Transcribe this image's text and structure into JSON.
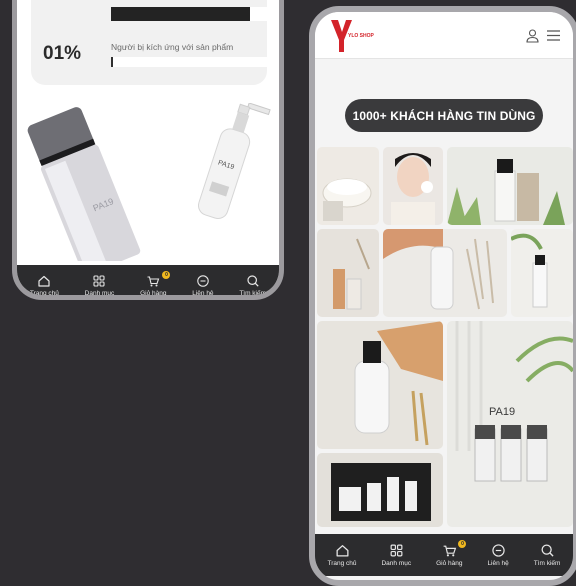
{
  "left_phone": {
    "rating": {
      "top_bar_fill": 0.88,
      "percent_text": "01%",
      "label": "Người bị kích ứng với sản phẩm",
      "bottom_bar_fill": 0.01
    }
  },
  "right_phone": {
    "brand_logo_letter": "Y",
    "brand_logo_sub": "YLO SHOP",
    "banner_label": "1000+ KHÁCH HÀNG TIN DÙNG",
    "gallery_items": [
      "product-photo",
      "customer-photo",
      "product-photo",
      "product-photo",
      "product-photo",
      "product-photo",
      "product-photo",
      "product-photo",
      "product-photo"
    ]
  },
  "nav": {
    "items": [
      {
        "label": "Trang chủ",
        "icon": "home-icon"
      },
      {
        "label": "Danh mục",
        "icon": "grid-icon"
      },
      {
        "label": "Giỏ hàng",
        "icon": "cart-icon",
        "badge": "0"
      },
      {
        "label": "Liên hệ",
        "icon": "chat-icon"
      },
      {
        "label": "Tìm kiếm",
        "icon": "search-icon"
      }
    ]
  },
  "colors": {
    "background": "#2f2d31",
    "nav_bg": "#2c2c2e",
    "badge": "#f0b81f",
    "brand_red": "#d3232a",
    "pill_bg": "#3a3a3c"
  }
}
